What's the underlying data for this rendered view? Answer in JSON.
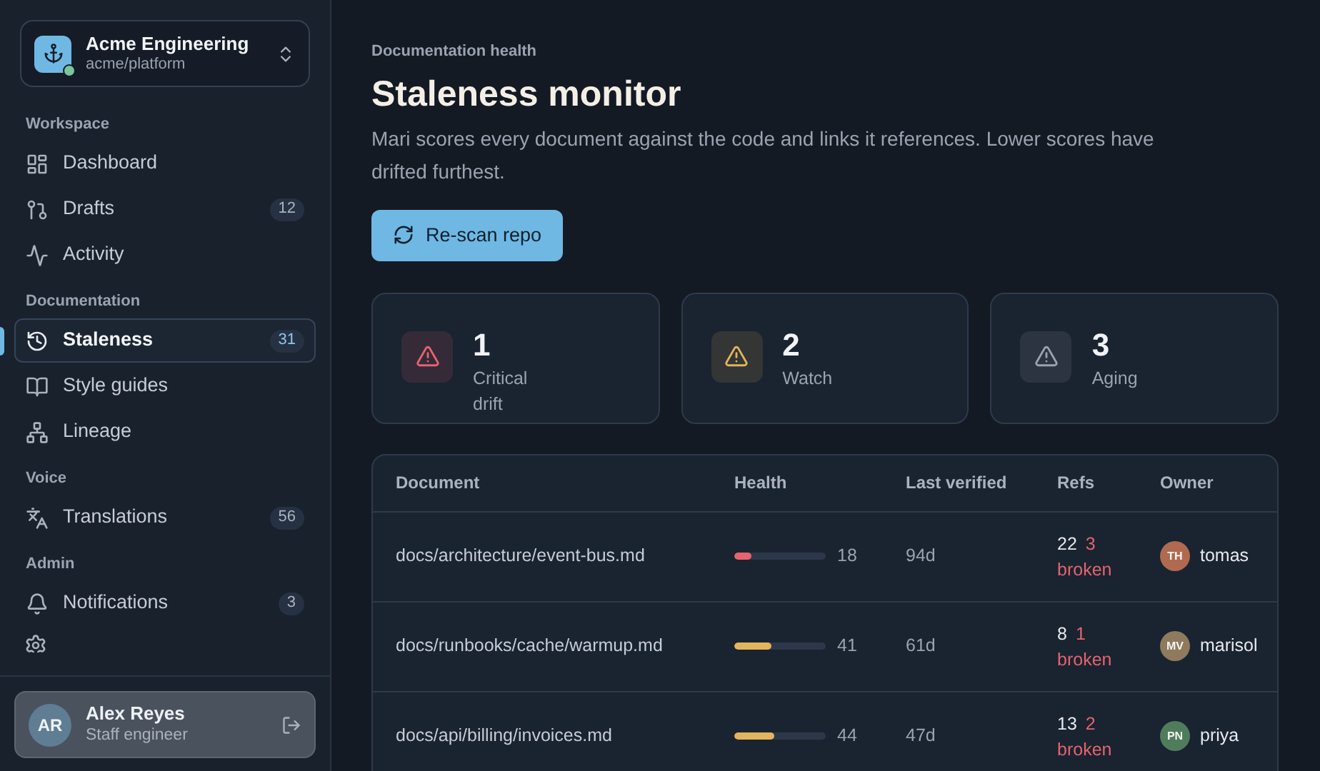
{
  "org": {
    "name": "Acme Engineering",
    "repo": "acme/platform",
    "online": true
  },
  "sidebar": {
    "sections": [
      {
        "label": "Workspace",
        "items": [
          {
            "label": "Dashboard",
            "selected": false
          },
          {
            "label": "Drafts",
            "badge": "12",
            "selected": false
          },
          {
            "label": "Activity",
            "selected": false
          }
        ]
      },
      {
        "label": "Documentation",
        "items": [
          {
            "label": "Staleness",
            "badge": "31",
            "selected": true
          },
          {
            "label": "Style guides",
            "selected": false
          },
          {
            "label": "Lineage",
            "selected": false
          }
        ]
      },
      {
        "label": "Voice",
        "items": [
          {
            "label": "Translations",
            "badge": "56",
            "selected": false
          }
        ]
      },
      {
        "label": "Admin",
        "items": [
          {
            "label": "Notifications",
            "badge": "3",
            "selected": false
          }
        ]
      }
    ]
  },
  "user": {
    "initials": "AR",
    "name": "Alex Reyes",
    "role": "Staff engineer"
  },
  "header": {
    "eyebrow": "Documentation health",
    "title": "Staleness monitor",
    "description": "Mari scores every document against the code and links it references. Lower scores have drifted furthest.",
    "button": "Re-scan repo"
  },
  "stats": [
    {
      "value": "1",
      "label": "Critical drift",
      "color": "#e5646e"
    },
    {
      "value": "2",
      "label": "Watch",
      "color": "#e2b45c"
    },
    {
      "value": "3",
      "label": "Aging",
      "color": "#9aa3b0"
    }
  ],
  "table": {
    "columns": [
      "Document",
      "Health",
      "Last verified",
      "Refs",
      "Owner"
    ],
    "rows": [
      {
        "document": "docs/architecture/event-bus.md",
        "health": {
          "level": 0.18,
          "score": "18",
          "color": "#e5646e"
        },
        "last_verified": "94d",
        "refs": "22",
        "broken": "3 broken",
        "owner": {
          "initials": "TH",
          "name": "tomas",
          "color": "#b06a4f"
        }
      },
      {
        "document": "docs/runbooks/cache/warmup.md",
        "health": {
          "level": 0.41,
          "score": "41",
          "color": "#e2b45c"
        },
        "last_verified": "61d",
        "refs": "8",
        "broken": "1 broken",
        "owner": {
          "initials": "MV",
          "name": "marisol",
          "color": "#8f7a5e"
        }
      },
      {
        "document": "docs/api/billing/invoices.md",
        "health": {
          "level": 0.44,
          "score": "44",
          "color": "#e2b45c"
        },
        "last_verified": "47d",
        "refs": "13",
        "broken": "2 broken",
        "owner": {
          "initials": "PN",
          "name": "priya",
          "color": "#4f7d5b"
        }
      }
    ]
  }
}
